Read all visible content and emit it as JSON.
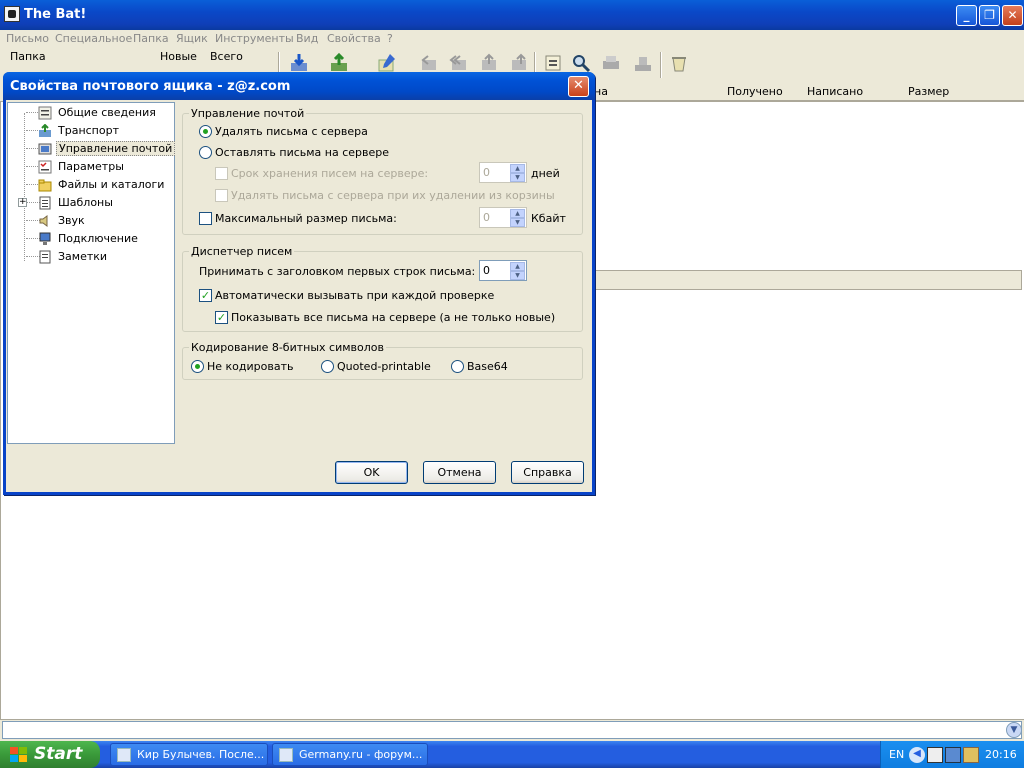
{
  "app": {
    "title": "The Bat!"
  },
  "menu": [
    "Письмо",
    "Специальное",
    "Папка",
    "Ящик",
    "Инструменты",
    "Вид",
    "Свойства",
    "?"
  ],
  "folder_header": {
    "folder": "Папка",
    "new": "Новые",
    "total": "Всего"
  },
  "columns": {
    "partial_sender": "на",
    "received": "Получено",
    "written": "Написано",
    "size": "Размер"
  },
  "dialog": {
    "title": "Свойства почтового ящика - z@z.com",
    "tree": [
      {
        "label": "Общие сведения"
      },
      {
        "label": "Транспорт"
      },
      {
        "label": "Управление почтой",
        "selected": true
      },
      {
        "label": "Параметры"
      },
      {
        "label": "Файлы и каталоги"
      },
      {
        "label": "Шаблоны",
        "expandable": true
      },
      {
        "label": "Звук"
      },
      {
        "label": "Подключение"
      },
      {
        "label": "Заметки"
      }
    ],
    "mail_mgmt": {
      "group_title": "Управление почтой",
      "delete_from_server": "Удалять письма с сервера",
      "leave_on_server": "Оставлять письма на сервере",
      "retention_label": "Срок хранения писем на сервере:",
      "retention_value": "0",
      "retention_unit": "дней",
      "delete_on_trash": "Удалять письма с сервера при их удалении из корзины",
      "max_size_label": "Максимальный размер письма:",
      "max_size_value": "0",
      "max_size_unit": "Кбайт"
    },
    "dispatcher": {
      "group_title": "Диспетчер писем",
      "header_lines_label": "Принимать с заголовком первых строк письма:",
      "header_lines_value": "0",
      "auto_invoke": "Автоматически вызывать при каждой проверке",
      "show_all": "Показывать все письма на сервере (а не только новые)"
    },
    "encoding": {
      "group_title": "Кодирование 8-битных символов",
      "none": "Не кодировать",
      "qp": "Quoted-printable",
      "b64": "Base64"
    },
    "buttons": {
      "ok": "OK",
      "cancel": "Отмена",
      "help": "Справка"
    }
  },
  "taskbar": {
    "start": "Start",
    "tasks": [
      "Кир Булычев. После...",
      "Germany.ru - форум..."
    ],
    "lang": "EN",
    "clock": "20:16"
  }
}
